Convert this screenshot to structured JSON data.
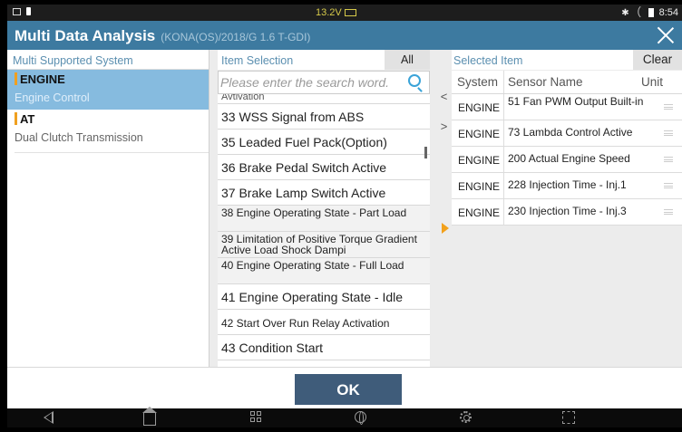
{
  "status_bar": {
    "voltage": "13.2V",
    "time": "8:54",
    "bluetooth_icon": "bluetooth-icon",
    "wifi_icon": "wifi-icon",
    "battery_icon": "battery-icon"
  },
  "title_bar": {
    "title": "Multi Data Analysis",
    "subtitle": "(KONA(OS)/2018/G 1.6 T-GDI)",
    "close_icon": "close-icon"
  },
  "left_panel": {
    "header": "Multi Supported System",
    "systems": [
      {
        "name": "ENGINE",
        "sub": "Engine Control",
        "selected": true
      },
      {
        "name": "AT",
        "sub": "Dual Clutch Transmission",
        "selected": false
      }
    ]
  },
  "middle_panel": {
    "header": "Item Selection",
    "all_button": "All",
    "search_placeholder": "Please enter the search word.",
    "cut_top_text": "Avtivation",
    "items": [
      "33 WSS Signal from ABS",
      "35 Leaded Fuel Pack(Option)",
      "36 Brake Pedal Switch Active",
      "37 Brake Lamp Switch Active",
      "38 Engine Operating State - Part Load",
      "39 Limitation of Positive Torque Gradient Active Load Shock Dampi",
      "40 Engine Operating State - Full Load",
      "41 Engine Operating State - Idle",
      "42 Start Over Run Relay Activation",
      "43 Condition Start"
    ]
  },
  "move_buttons": {
    "left": "<",
    "right": ">"
  },
  "right_panel": {
    "header": "Selected Item",
    "clear_button": "Clear",
    "columns": {
      "system": "System",
      "sensor": "Sensor Name",
      "unit": "Unit"
    },
    "rows": [
      {
        "system": "ENGINE",
        "sensor": "51 Fan PWM Output Built-in"
      },
      {
        "system": "ENGINE",
        "sensor": "73 Lambda Control Active"
      },
      {
        "system": "ENGINE",
        "sensor": "200 Actual Engine Speed"
      },
      {
        "system": "ENGINE",
        "sensor": "228 Injection Time - Inj.1"
      },
      {
        "system": "ENGINE",
        "sensor": "230 Injection Time - Inj.3"
      }
    ],
    "accent_color": "#f2a11c"
  },
  "footer": {
    "ok_button": "OK"
  },
  "nav_bar": {
    "icons": [
      "back-icon",
      "home-icon",
      "apps-icon",
      "globe-icon",
      "settings-icon",
      "screenshot-icon"
    ]
  },
  "colors": {
    "title_bar": "#3d7aa0",
    "selected_system": "#86bbdf",
    "ok_button": "#3f5c7a",
    "accent": "#f0a020"
  }
}
